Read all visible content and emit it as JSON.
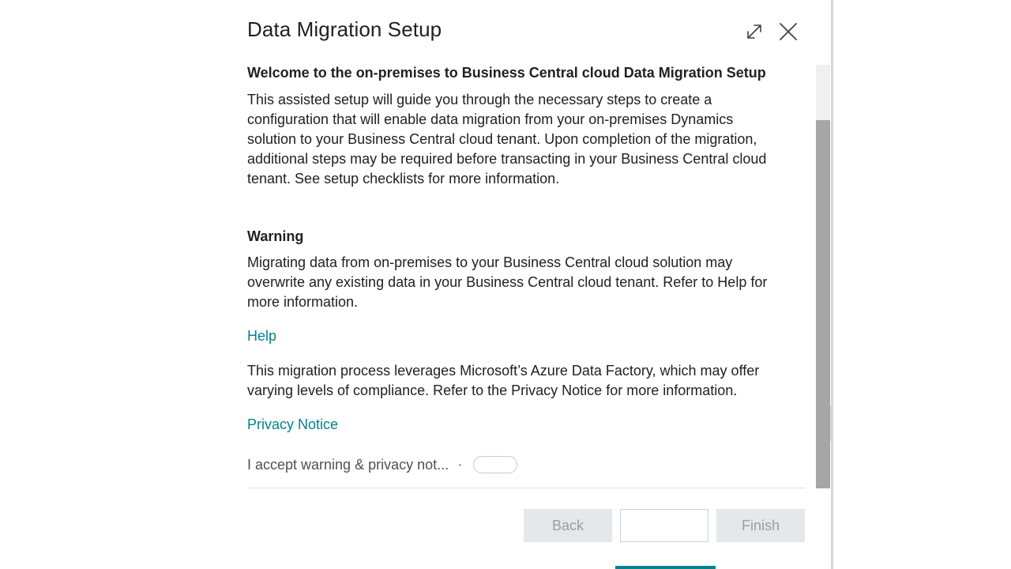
{
  "dialog": {
    "title": "Data Migration Setup"
  },
  "content": {
    "welcome_heading": "Welcome to the on-premises to Business Central cloud Data Migration Setup",
    "welcome_lines": [
      "This assisted setup will guide you through the necessary steps to create a",
      "configuration that will enable data migration from your on-premises Dynamics",
      "solution to your Business Central cloud tenant. Upon completion of the migration,",
      "additional steps may be required before transacting in your Business Central cloud",
      "tenant. See setup checklists for more information."
    ],
    "warning_heading": "Warning",
    "warning_lines": [
      "Migrating data from on-premises to your Business Central cloud solution may",
      "overwrite any existing data in your Business Central cloud tenant. Refer to Help for",
      "more information."
    ],
    "help_link": "Help",
    "azure_lines": [
      "This migration process leverages Microsoft’s Azure Data Factory, which may offer",
      "varying levels of compliance. Refer to the Privacy Notice for more information."
    ],
    "privacy_link": "Privacy Notice",
    "accept_label": "I accept warning & privacy not...",
    "accept_value": false
  },
  "footer": {
    "back_label": "Back",
    "next_label": "",
    "finish_label": "Finish"
  },
  "icons": {
    "expand": "expand-icon",
    "close": "close-icon"
  },
  "colors": {
    "link": "#00838f",
    "disabled_button_bg": "#e5e7ea",
    "disabled_button_text": "#9aa0a6",
    "scrollbar_thumb": "#a6a6a6"
  }
}
